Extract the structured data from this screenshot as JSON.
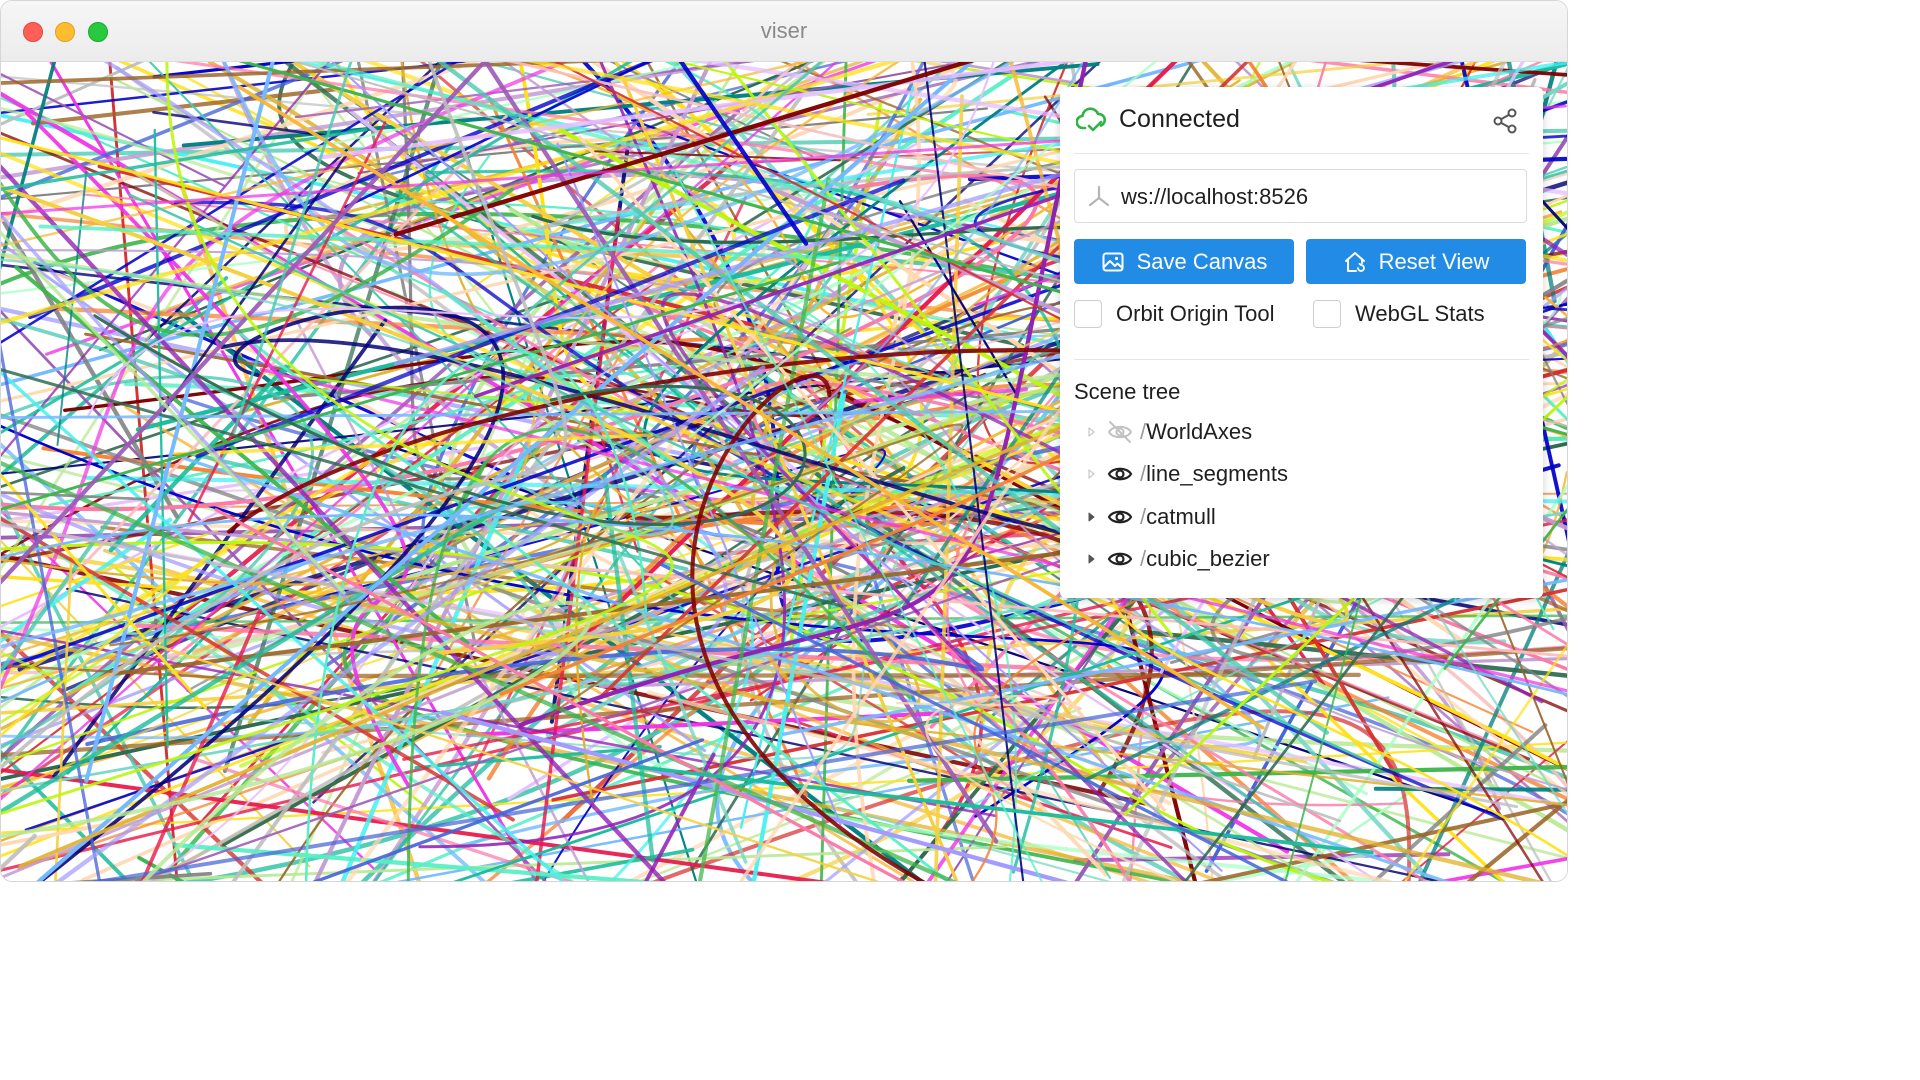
{
  "window": {
    "title": "viser"
  },
  "panel": {
    "status": "Connected",
    "server_url": "ws://localhost:8526",
    "buttons": {
      "save_canvas": "Save Canvas",
      "reset_view": "Reset View"
    },
    "checkboxes": [
      {
        "label": "Orbit Origin Tool",
        "checked": false
      },
      {
        "label": "WebGL Stats",
        "checked": false
      }
    ],
    "scene_tree": {
      "title": "Scene tree",
      "items": [
        {
          "prefix": "/",
          "name": "WorldAxes",
          "visible": false,
          "expandable": false
        },
        {
          "prefix": "/",
          "name": "line_segments",
          "visible": true,
          "expandable": false
        },
        {
          "prefix": "/",
          "name": "catmull",
          "visible": true,
          "expandable": true
        },
        {
          "prefix": "/",
          "name": "cubic_bezier",
          "visible": true,
          "expandable": true
        }
      ]
    }
  },
  "colors": {
    "accent": "#228be6",
    "connected": "#2fb344"
  }
}
